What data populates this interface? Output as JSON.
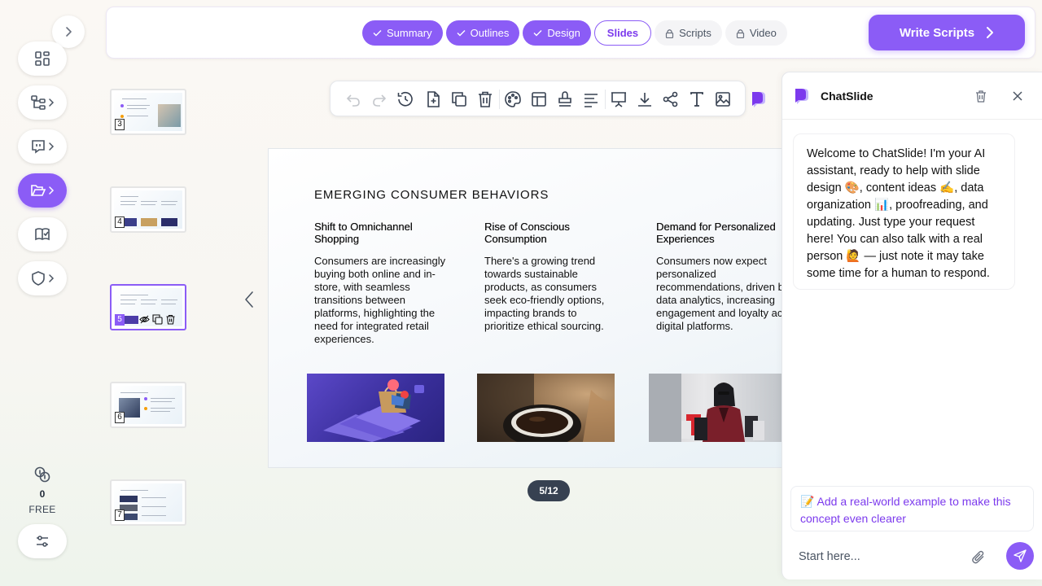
{
  "steps": [
    {
      "label": "Summary",
      "state": "done"
    },
    {
      "label": "Outlines",
      "state": "done"
    },
    {
      "label": "Design",
      "state": "done"
    },
    {
      "label": "Slides",
      "state": "current"
    },
    {
      "label": "Scripts",
      "state": "locked"
    },
    {
      "label": "Video",
      "state": "locked"
    }
  ],
  "write_scripts_label": "Write Scripts",
  "credits": {
    "value": "0",
    "plan": "FREE"
  },
  "thumbnails": [
    "3",
    "4",
    "5",
    "6",
    "7"
  ],
  "slide": {
    "title": "EMERGING CONSUMER BEHAVIORS",
    "columns": [
      {
        "heading": "Shift to Omnichannel Shopping",
        "body": "Consumers are increasingly buying both online and in-store, with seamless transitions between platforms, highlighting the need for integrated retail experiences."
      },
      {
        "heading": "Rise of Conscious Consumption",
        "body": "There's a growing trend towards sustainable products, as consumers seek eco-friendly options, impacting brands to prioritize ethical sourcing."
      },
      {
        "heading": "Demand for Personalized Experiences",
        "body": "Consumers now expect personalized recommendations, driven by data analytics, increasing engagement and loyalty across digital platforms."
      }
    ]
  },
  "page_indicator": "5/12",
  "chat": {
    "title": "ChatSlide",
    "welcome": "Welcome to ChatSlide! I'm your AI assistant, ready to help with slide design 🎨, content ideas ✍️, data organization 📊, proofreading, and updating. Just type your request here! You can also talk with a real person 🙋 — just note it may take some time for a human to respond.",
    "suggestion": "📝 Add a real-world example to make this concept even clearer",
    "input_placeholder": "Start here..."
  },
  "colors": {
    "accent": "#8b5cf6",
    "accent_dark": "#7c3aed",
    "pill_dark": "#374151"
  }
}
